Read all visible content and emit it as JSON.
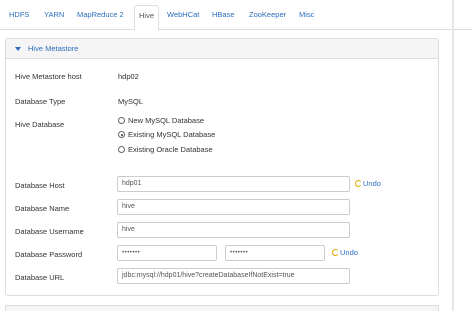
{
  "tabs": [
    {
      "label": "HDFS",
      "active": false
    },
    {
      "label": "YARN",
      "active": false
    },
    {
      "label": "MapReduce 2",
      "active": false
    },
    {
      "label": "Hive",
      "active": true
    },
    {
      "label": "WebHCat",
      "active": false
    },
    {
      "label": "HBase",
      "active": false
    },
    {
      "label": "ZooKeeper",
      "active": false
    },
    {
      "label": "Misc",
      "active": false
    }
  ],
  "panel": {
    "title": "Hive Metastore",
    "metastore_host_label": "Hive Metastore host",
    "metastore_host_value": "hdp02",
    "db_type_label": "Database Type",
    "db_type_value": "MySQL",
    "hive_db_label": "Hive Database",
    "hive_db_options": [
      {
        "label": "New MySQL Database",
        "checked": false
      },
      {
        "label": "Existing MySQL Database",
        "checked": true
      },
      {
        "label": "Existing Oracle Database",
        "checked": false
      }
    ],
    "db_host_label": "Database Host",
    "db_host_value": "hdp01",
    "db_name_label": "Database Name",
    "db_name_value": "hive",
    "db_user_label": "Database Username",
    "db_user_value": "hive",
    "db_password_label": "Database Password",
    "db_password_value": "•••••••",
    "db_password_confirm_value": "•••••••",
    "db_url_label": "Database URL",
    "db_url_value": "jdbc:mysql://hdp01/hive?createDatabaseIfNotExist=true",
    "undo_label": "Undo"
  },
  "colors": {
    "link": "#2a6ebd",
    "undo_icon": "#e0a800",
    "border": "#dddddd",
    "heading_bg": "#f5f5f5"
  }
}
